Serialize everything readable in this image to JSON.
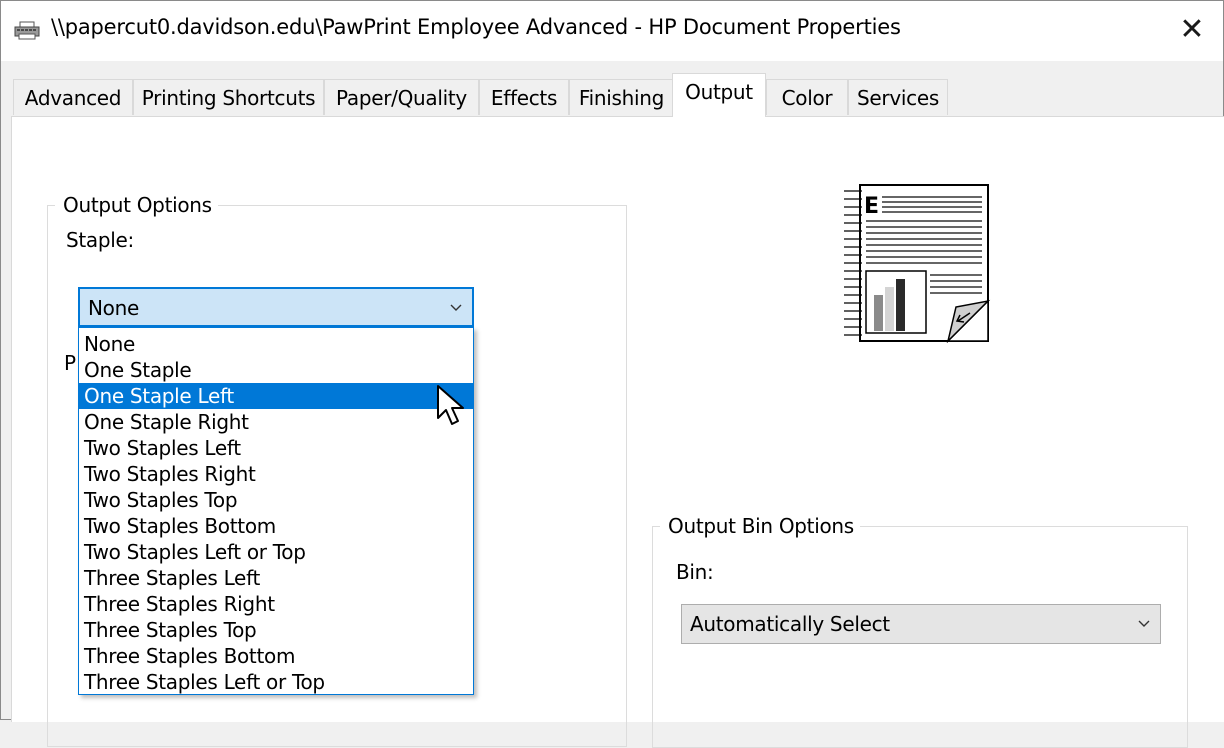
{
  "window": {
    "title": "\\\\papercut0.davidson.edu\\PawPrint Employee Advanced - HP Document Properties",
    "close_glyph": "✕"
  },
  "tabs": [
    {
      "label": "Advanced",
      "active": false
    },
    {
      "label": "Printing Shortcuts",
      "active": false
    },
    {
      "label": "Paper/Quality",
      "active": false
    },
    {
      "label": "Effects",
      "active": false
    },
    {
      "label": "Finishing",
      "active": false
    },
    {
      "label": "Output",
      "active": true
    },
    {
      "label": "Color",
      "active": false
    },
    {
      "label": "Services",
      "active": false
    }
  ],
  "output_options": {
    "legend": "Output Options",
    "staple_label": "Staple:",
    "staple_value": "None",
    "obscured_label_start": "P",
    "staple_options": [
      "None",
      "One Staple",
      "One Staple Left",
      "One Staple Right",
      "Two Staples Left",
      "Two Staples Right",
      "Two Staples Top",
      "Two Staples Bottom",
      "Two Staples Left or Top",
      "Three Staples Left",
      "Three Staples Right",
      "Three Staples Top",
      "Three Staples Bottom",
      "Three Staples Left or Top"
    ],
    "highlighted_option": "One Staple Left"
  },
  "output_bin_options": {
    "legend": "Output Bin Options",
    "bin_label": "Bin:",
    "bin_value": "Automatically Select"
  },
  "icons": {
    "printer": "printer-icon",
    "document_preview": "document-preview-icon",
    "chevron": "chevron-down-icon",
    "cursor": "mouse-pointer-icon"
  },
  "colors": {
    "accent": "#0078d7",
    "combo_focus_bg": "#cce4f7",
    "panel_bg": "#ffffff",
    "window_bg": "#f0f0f0"
  }
}
